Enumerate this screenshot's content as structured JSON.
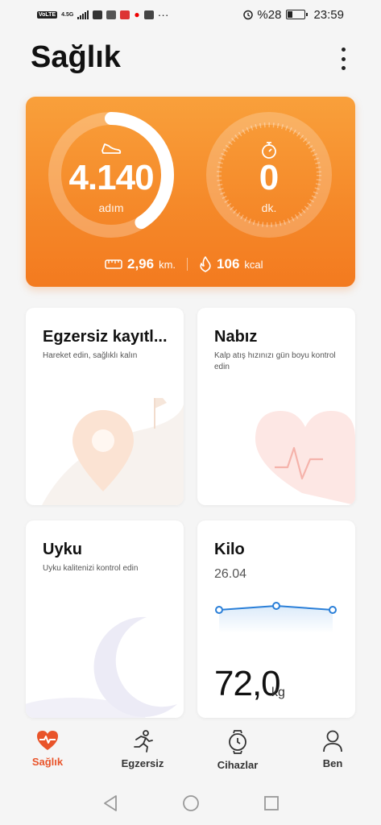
{
  "status_bar": {
    "network_badge": "VoLTE",
    "network_type": "4.5G",
    "battery_text": "%28",
    "time": "23:59",
    "dots": "···",
    "icons": [
      "volte-icon",
      "signal-icon",
      "calendar-icon",
      "app-icon",
      "app-icon",
      "vodafone-icon",
      "message-icon",
      "alarm-icon",
      "battery-icon"
    ]
  },
  "header": {
    "title": "Sağlık",
    "more_icon": "more-vert-icon"
  },
  "summary": {
    "steps_value": "4.140",
    "steps_unit": "adım",
    "steps_progress": 0.41,
    "minutes_value": "0",
    "minutes_unit": "dk.",
    "distance_value": "2,96",
    "distance_unit": "km.",
    "calories_value": "106",
    "calories_unit": "kcal",
    "colors": {
      "accent_top": "#f9a03b",
      "accent_bottom": "#f37a1f"
    }
  },
  "tiles": {
    "exercise": {
      "title": "Egzersiz kayıtl...",
      "subtitle": "Hareket edin, sağlıklı kalın"
    },
    "heart": {
      "title": "Nabız",
      "subtitle": "Kalp atış hızınızı gün boyu kontrol edin"
    },
    "sleep": {
      "title": "Uyku",
      "subtitle": "Uyku kalitenizi kontrol edin"
    },
    "weight": {
      "title": "Kilo",
      "date": "26.04",
      "value": "72,0",
      "unit": "kg"
    }
  },
  "bottom_nav": {
    "items": [
      {
        "label": "Sağlık",
        "icon": "heart-pulse-icon",
        "active": true
      },
      {
        "label": "Egzersiz",
        "icon": "running-icon",
        "active": false
      },
      {
        "label": "Cihazlar",
        "icon": "watch-icon",
        "active": false
      },
      {
        "label": "Ben",
        "icon": "person-icon",
        "active": false
      }
    ],
    "active_color": "#e9542a"
  },
  "system_nav": {
    "back": "back-icon",
    "home": "home-icon",
    "recents": "recents-icon"
  }
}
